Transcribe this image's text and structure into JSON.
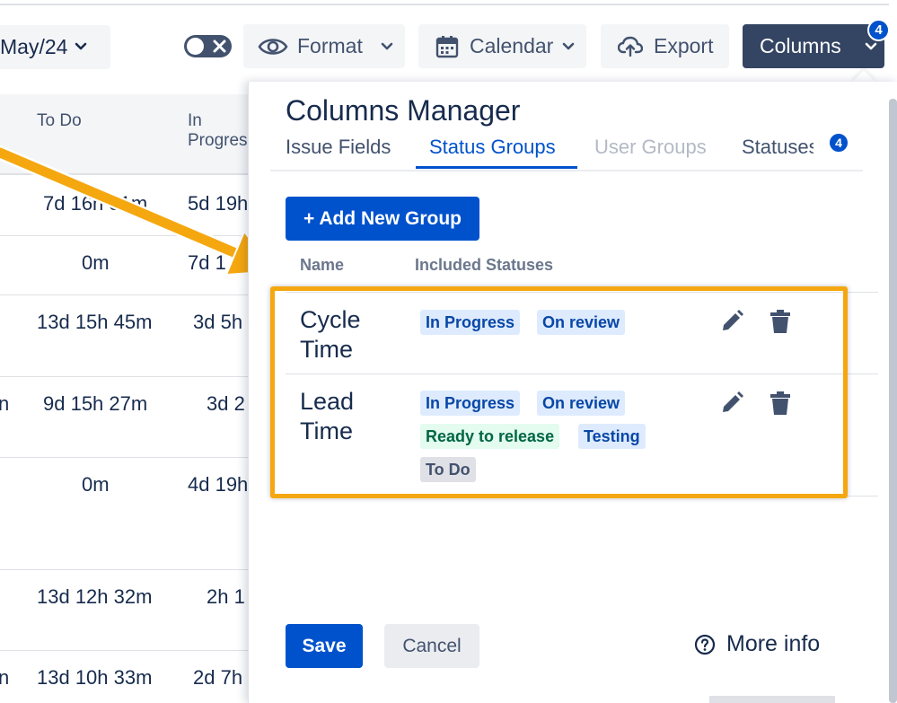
{
  "toolbar": {
    "date_value": "May/24",
    "format_label": "Format",
    "calendar_label": "Calendar",
    "export_label": "Export",
    "columns_label": "Columns",
    "columns_badge": "4",
    "toggle_state": "off"
  },
  "table": {
    "headers": [
      "To Do",
      "In Progress"
    ],
    "rows": [
      {
        "left": "",
        "todo": "7d 16h 31m",
        "inprog": "5d 19h"
      },
      {
        "left": "",
        "todo": "0m",
        "inprog": "7d 1"
      },
      {
        "left": "",
        "todo": "13d 15h 45m",
        "inprog": "3d 5h"
      },
      {
        "left": "n",
        "todo": "9d 15h 27m",
        "inprog": "3d 2"
      },
      {
        "left": "",
        "todo": "0m",
        "inprog": "4d 19h"
      },
      {
        "left": "",
        "todo": "13d 12h 32m",
        "inprog": "2h 1"
      },
      {
        "left": "n",
        "todo": "13d 10h 33m",
        "inprog": "2d 7h"
      }
    ]
  },
  "modal": {
    "title": "Columns Manager",
    "tabs": [
      {
        "label": "Issue Fields",
        "state": "normal"
      },
      {
        "label": "Status Groups",
        "state": "active"
      },
      {
        "label": "User Groups",
        "state": "disabled"
      },
      {
        "label": "Statuses",
        "state": "normal",
        "badge": "4"
      }
    ],
    "add_button_label": "+ Add New Group",
    "column_headers": {
      "name": "Name",
      "included": "Included Statuses"
    },
    "groups": [
      {
        "name": "Cycle Time",
        "statuses": [
          {
            "label": "In Progress",
            "color": "blue"
          },
          {
            "label": "On review",
            "color": "blue"
          }
        ]
      },
      {
        "name": "Lead Time",
        "statuses": [
          {
            "label": "In Progress",
            "color": "blue"
          },
          {
            "label": "On review",
            "color": "blue"
          },
          {
            "label": "Ready to release",
            "color": "green"
          },
          {
            "label": "Testing",
            "color": "blue"
          },
          {
            "label": "To Do",
            "color": "grey"
          }
        ]
      }
    ],
    "save_label": "Save",
    "cancel_label": "Cancel",
    "more_info_label": "More info"
  },
  "colors": {
    "primary": "#0052cc",
    "dark_button": "#344563",
    "highlight": "#f5a70f",
    "tag_blue_bg": "#deebff",
    "tag_green_bg": "#e3fcef",
    "tag_grey_bg": "#dfe1e6"
  }
}
